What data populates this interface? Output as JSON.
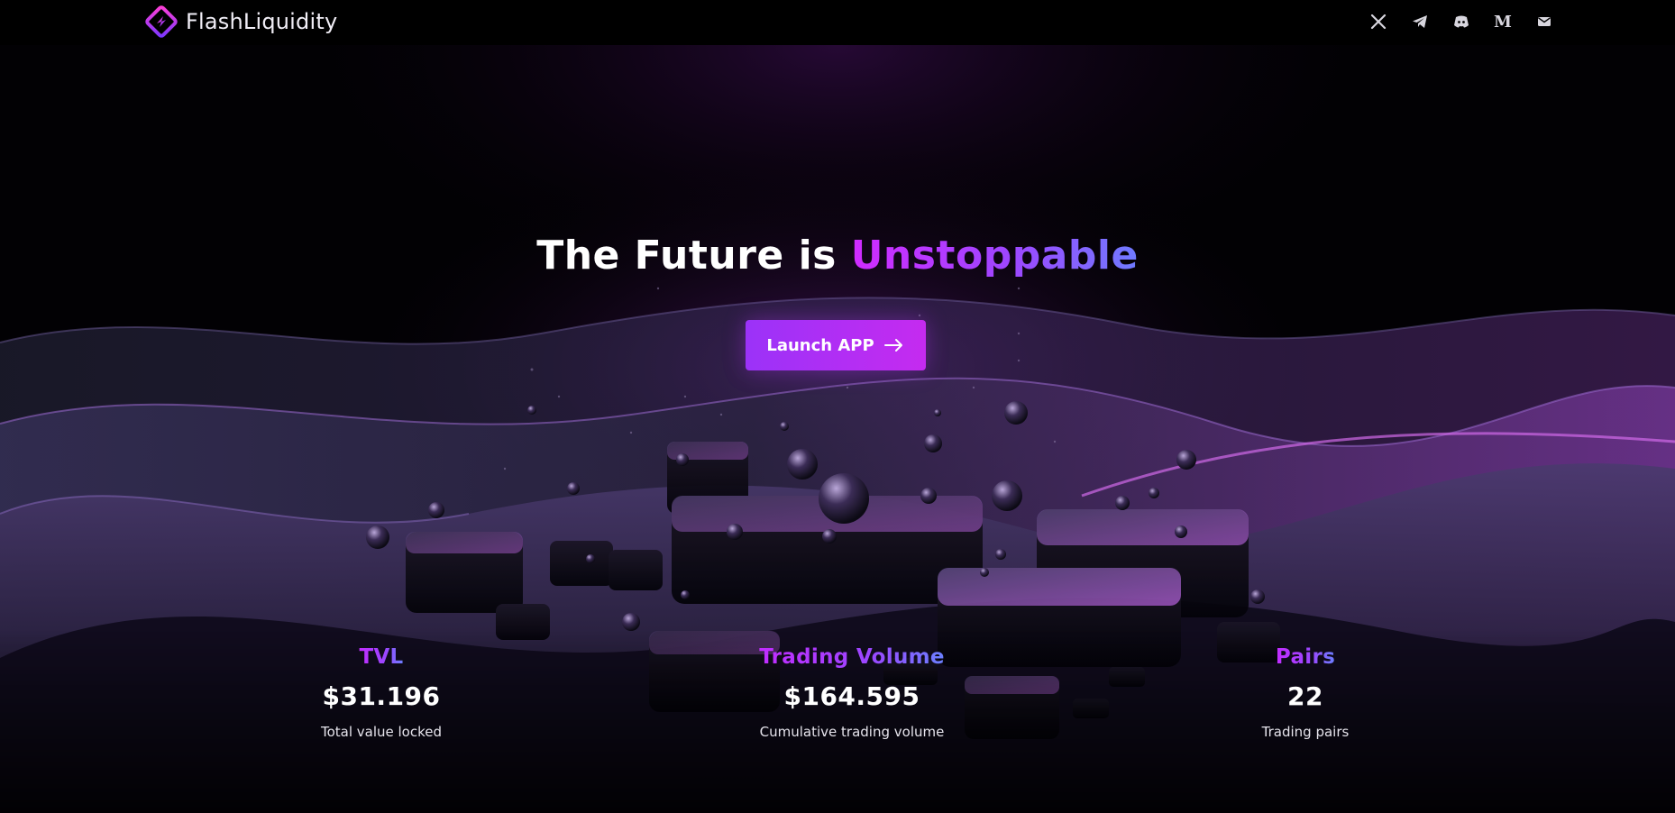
{
  "header": {
    "brand": "FlashLiquidity",
    "socials": [
      {
        "name": "x",
        "icon": "x-icon"
      },
      {
        "name": "telegram",
        "icon": "telegram-icon"
      },
      {
        "name": "discord",
        "icon": "discord-icon"
      },
      {
        "name": "medium",
        "icon": "medium-icon",
        "glyph": "M"
      },
      {
        "name": "email",
        "icon": "mail-icon"
      }
    ]
  },
  "hero": {
    "headline_prefix": "The Future is ",
    "headline_accent": "Unstoppable",
    "cta_label": "Launch APP"
  },
  "stats": [
    {
      "title": "TVL",
      "value": "$31.196",
      "caption": "Total value locked"
    },
    {
      "title": "Trading Volume",
      "value": "$164.595",
      "caption": "Cumulative trading volume"
    },
    {
      "title": "Pairs",
      "value": "22",
      "caption": "Trading pairs"
    }
  ],
  "colors": {
    "accent_magenta": "#c52bf0",
    "accent_violet": "#9b32f8",
    "accent_blue": "#6f7bff",
    "background": "#000000"
  }
}
